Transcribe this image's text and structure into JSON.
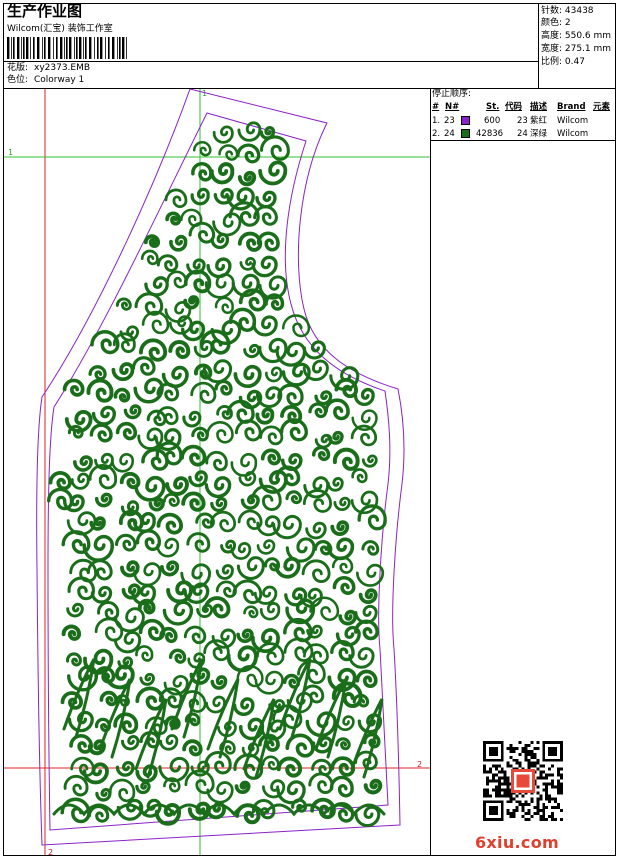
{
  "header": {
    "title": "生产作业图",
    "company": "Wilcom(汇宝) 装饰工作室",
    "design_label": "花版:",
    "design_value": "xy2373.EMB",
    "colorway_label": "色位:",
    "colorway_value": "Colorway 1"
  },
  "stats": {
    "stitches": "针数: 43438",
    "colors": "颜色: 2",
    "height": "高度: 550.6 mm",
    "width": "宽度: 275.1 mm",
    "scale": "比例: 0.47"
  },
  "stop_sequence": {
    "label": "停止顺序:",
    "headers": [
      "#",
      "N#",
      "St.",
      "代码",
      "描述",
      "Brand",
      "元素"
    ],
    "rows": [
      {
        "index": "1.",
        "n": "23",
        "color": "#8a22c8",
        "st": "600",
        "code": "23",
        "desc": "紫红",
        "brand": "Wilcom"
      },
      {
        "index": "2.",
        "n": "24",
        "color": "#1a6e1a",
        "st": "42836",
        "code": "24",
        "desc": "深绿",
        "brand": "Wilcom"
      }
    ]
  },
  "canvas": {
    "guide_labels": {
      "top": "1",
      "left": "1",
      "right": "2",
      "bottom": "2"
    },
    "outline_color": "#8a22c8",
    "fill_color": "#1a6e1a",
    "guide_red": "#e02020",
    "guide_green": "#30c030"
  },
  "watermark": "6xiu.com"
}
